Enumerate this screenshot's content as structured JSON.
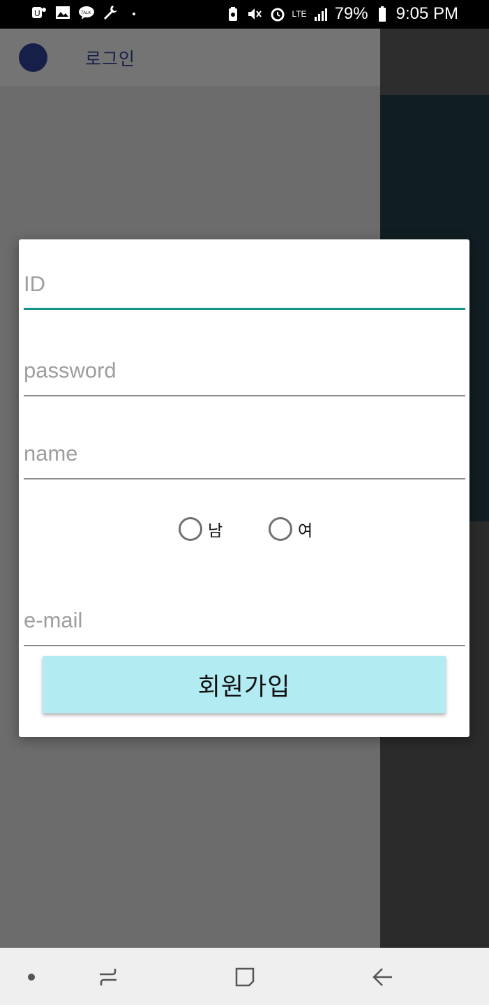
{
  "status_bar": {
    "battery": "79%",
    "time": "9:05 PM",
    "network": "LTE",
    "left_icons": [
      "u-plus-icon",
      "gallery-icon",
      "kakaotalk-icon",
      "wrench-icon",
      "dot-icon"
    ],
    "right_icons": [
      "battery-saver-icon",
      "mute-icon",
      "alarm-icon",
      "lte-icon",
      "signal-icon",
      "battery-icon"
    ]
  },
  "drawer": {
    "login_label": "로그인",
    "avatar_color": "#2c3e91"
  },
  "dialog": {
    "id_placeholder": "ID",
    "password_placeholder": "password",
    "name_placeholder": "name",
    "gender_options": [
      "남",
      "여"
    ],
    "email_placeholder": "e-mail",
    "signup_button_label": "회원가입",
    "accent_color": "#16928a",
    "button_color": "#b3ebf2"
  },
  "nav_bar": {
    "icons": [
      "dot-icon",
      "recents-icon",
      "home-icon",
      "back-icon"
    ]
  }
}
